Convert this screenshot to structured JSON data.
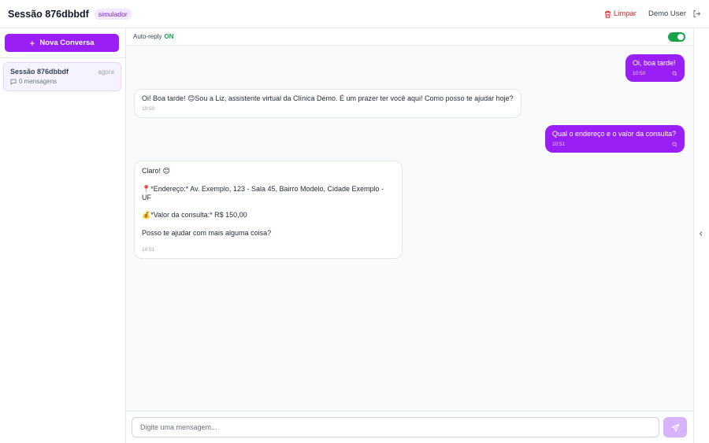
{
  "header": {
    "title": "Sessão 876dbbdf",
    "badge": "simulador",
    "clear_label": "Limpar",
    "user_name": "Demo User"
  },
  "sidebar": {
    "new_button_label": "Nova Conversa",
    "conversations": [
      {
        "name": "Sessão 876dbbdf",
        "time": "agora",
        "count": "0 mensagens"
      }
    ]
  },
  "chat": {
    "autoreply_label": "Auto-reply",
    "autoreply_state": "ON",
    "messages": [
      {
        "role": "user",
        "lines": [
          "Oi, boa tarde!"
        ],
        "time": "10:50"
      },
      {
        "role": "bot",
        "lines": [
          "Oi! Boa tarde! 😊Sou a Liz, assistente virtual da Clínica Demo. É um prazer ter você aqui! Como posso te ajudar hoje?"
        ],
        "time": "10:50"
      },
      {
        "role": "user",
        "lines": [
          "Qual o endereço e o valor da consulta?"
        ],
        "time": "10:51"
      },
      {
        "role": "bot",
        "lines": [
          "Claro! 😊",
          "📍*Endereço:* Av. Exemplo, 123 - Sala 45, Bairro Modelo, Cidade Exemplo - UF",
          "💰*Valor da consulta:* R$ 150,00",
          "Posso te ajudar com mais alguma coisa?"
        ],
        "time": "10:51"
      }
    ]
  },
  "composer": {
    "placeholder": "Digite uma mensagem..."
  },
  "colors": {
    "accent": "#9a1ff5",
    "on": "#16a34a",
    "danger": "#dc2626"
  }
}
